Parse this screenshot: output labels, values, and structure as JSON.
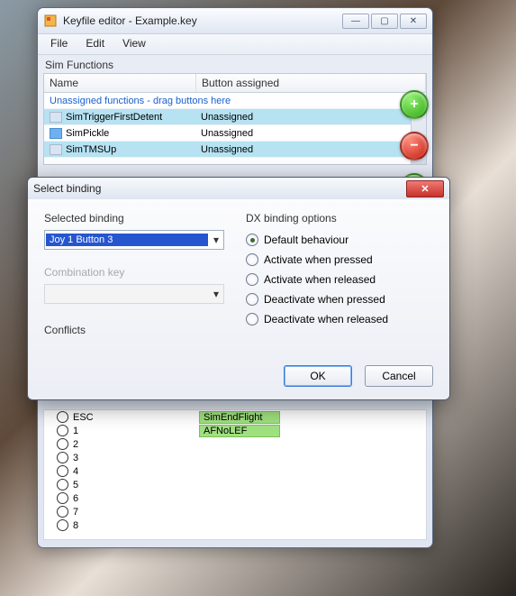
{
  "main": {
    "title": "Keyfile editor - Example.key",
    "menu": {
      "file": "File",
      "edit": "Edit",
      "view": "View"
    },
    "section_label": "Sim Functions",
    "columns": {
      "name": "Name",
      "assigned": "Button assigned"
    },
    "group_row": "Unassigned functions - drag buttons here",
    "rows": [
      {
        "name": "SimTriggerFirstDetent",
        "assigned": "Unassigned",
        "sel": true,
        "iconBlue": false
      },
      {
        "name": "SimPickle",
        "assigned": "Unassigned",
        "sel": false,
        "iconBlue": true
      },
      {
        "name": "SimTMSUp",
        "assigned": "Unassigned",
        "sel": true,
        "iconBlue": false
      }
    ],
    "side_buttons": {
      "add": "+",
      "remove": "−",
      "up": "▲"
    },
    "lower": {
      "items": [
        {
          "label": "ESC",
          "val": "SimEndFlight"
        },
        {
          "label": "1",
          "val": "AFNoLEF"
        },
        {
          "label": "2",
          "val": ""
        },
        {
          "label": "3",
          "val": ""
        },
        {
          "label": "4",
          "val": ""
        },
        {
          "label": "5",
          "val": ""
        },
        {
          "label": "6",
          "val": ""
        },
        {
          "label": "7",
          "val": ""
        },
        {
          "label": "8",
          "val": ""
        }
      ]
    }
  },
  "dialog": {
    "title": "Select binding",
    "selected_binding_label": "Selected binding",
    "selected_binding_value": "Joy 1 Button 3",
    "combination_key_label": "Combination key",
    "conflicts_label": "Conflicts",
    "dx_label": "DX binding options",
    "radios": {
      "default": "Default behaviour",
      "act_press": "Activate when pressed",
      "act_release": "Activate when released",
      "deact_press": "Deactivate when pressed",
      "deact_release": "Deactivate when released"
    },
    "ok": "OK",
    "cancel": "Cancel",
    "close_glyph": "✕"
  }
}
